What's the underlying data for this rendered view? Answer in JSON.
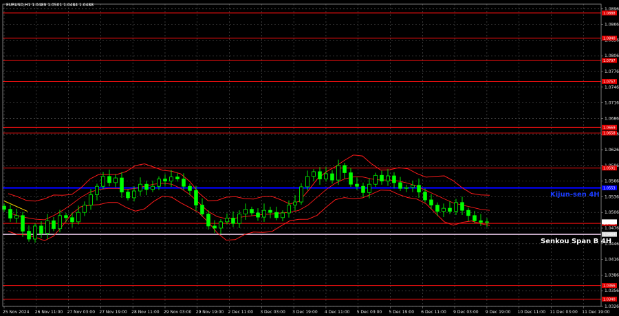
{
  "header": {
    "symbol_line": "EURUSD,H1  1.0489 1.0501 1.0484 1.0488"
  },
  "colors": {
    "background": "#000000",
    "grid": "#5a5a5a",
    "candle": "#00ff00",
    "kijun_h4": "#0000ff",
    "senkou_b_h4": "#e8c8e8",
    "level_line": "#ff1010",
    "bands": "#ff1a1a",
    "yellow": "#ffd700"
  },
  "labels": {
    "kijun": "Kijun-sen 4H",
    "senkou": "Senkou Span B 4H"
  },
  "chart_data": {
    "type": "candlestick",
    "title": "EURUSD,H1",
    "ylim": [
      1.0326,
      1.0905
    ],
    "y_ticks": [
      "1.0896",
      "1.0866",
      "1.0836",
      "1.0806",
      "1.0776",
      "1.0746",
      "1.0716",
      "1.0686",
      "1.0656",
      "1.0626",
      "1.0596",
      "1.0566",
      "1.0536",
      "1.0506",
      "1.0476",
      "1.0446",
      "1.0416",
      "1.0386",
      "1.0356",
      "1.0326"
    ],
    "x_ticks": [
      "25 Nov 2024",
      "26 Nov 11:00",
      "27 Nov 03:00",
      "27 Nov 19:00",
      "28 Nov 11:00",
      "29 Nov 03:00",
      "29 Nov 19:00",
      "2 Dec 11:00",
      "3 Dec 03:00",
      "3 Dec 19:00",
      "4 Dec 11:00",
      "5 Dec 03:00",
      "5 Dec 19:00",
      "6 Dec 11:00",
      "9 Dec 03:00",
      "9 Dec 19:00",
      "10 Dec 11:00",
      "11 Dec 03:00",
      "11 Dec 19:00"
    ],
    "price_levels": [
      {
        "value": 1.0888,
        "label": "1.0888"
      },
      {
        "value": 1.084,
        "label": "1.0840"
      },
      {
        "value": 1.0797,
        "label": "1.0797"
      },
      {
        "value": 1.0757,
        "label": "1.0757"
      },
      {
        "value": 1.0669,
        "label": "1.0669"
      },
      {
        "value": 1.0658,
        "label": "1.0658"
      },
      {
        "value": 1.0591,
        "label": "1.0591"
      },
      {
        "value": 1.0485,
        "label": "1.0485"
      },
      {
        "value": 1.0366,
        "label": "1.0366"
      },
      {
        "value": 1.034,
        "label": "1.0340"
      }
    ],
    "kijun_sen_4h": {
      "value": 1.0553,
      "label": "1.0553"
    },
    "senkou_span_b_4h": {
      "value": 1.0464,
      "label": "1.0464"
    },
    "current_price": {
      "value": 1.0488,
      "label": "1.0488"
    },
    "closes": [
      1.0512,
      1.0495,
      1.05,
      1.047,
      1.0455,
      1.048,
      1.0466,
      1.049,
      1.0475,
      1.05,
      1.0496,
      1.0488,
      1.0506,
      1.052,
      1.054,
      1.0556,
      1.0575,
      1.0563,
      1.0572,
      1.0545,
      1.0534,
      1.0547,
      1.056,
      1.055,
      1.0556,
      1.057,
      1.0566,
      1.0574,
      1.057,
      1.0556,
      1.0548,
      1.052,
      1.0503,
      1.048,
      1.0476,
      1.0488,
      1.0495,
      1.0485,
      1.0503,
      1.0512,
      1.0505,
      1.0497,
      1.051,
      1.0506,
      1.0496,
      1.0505,
      1.052,
      1.0526,
      1.0555,
      1.0575,
      1.0584,
      1.057,
      1.058,
      1.0568,
      1.0596,
      1.0582,
      1.056,
      1.0556,
      1.0544,
      1.056,
      1.0577,
      1.0566,
      1.0576,
      1.0563,
      1.0552,
      1.0554,
      1.0558,
      1.0545,
      1.053,
      1.052,
      1.0508,
      1.0514,
      1.0508,
      1.0525,
      1.051,
      1.05,
      1.049,
      1.0487,
      1.0488
    ],
    "kijun_line_series": [
      1.0506,
      1.05,
      1.0496,
      1.0493,
      1.0492,
      1.05,
      1.051,
      1.0522,
      1.0535,
      1.0545,
      1.055,
      1.0552,
      1.0552,
      1.055,
      1.0552,
      1.0556,
      1.056,
      1.0562,
      1.056,
      1.0552,
      1.054,
      1.0524,
      1.0508,
      1.0498,
      1.0494,
      1.0495,
      1.0498,
      1.05,
      1.0502,
      1.0503,
      1.0505,
      1.0506,
      1.051,
      1.052,
      1.0535,
      1.055,
      1.0562,
      1.057,
      1.0574,
      1.0574,
      1.057,
      1.0568,
      1.0568,
      1.0566,
      1.0562,
      1.0556,
      1.0548,
      1.054,
      1.0532,
      1.0524,
      1.052,
      1.0516,
      1.0512,
      1.051
    ]
  }
}
